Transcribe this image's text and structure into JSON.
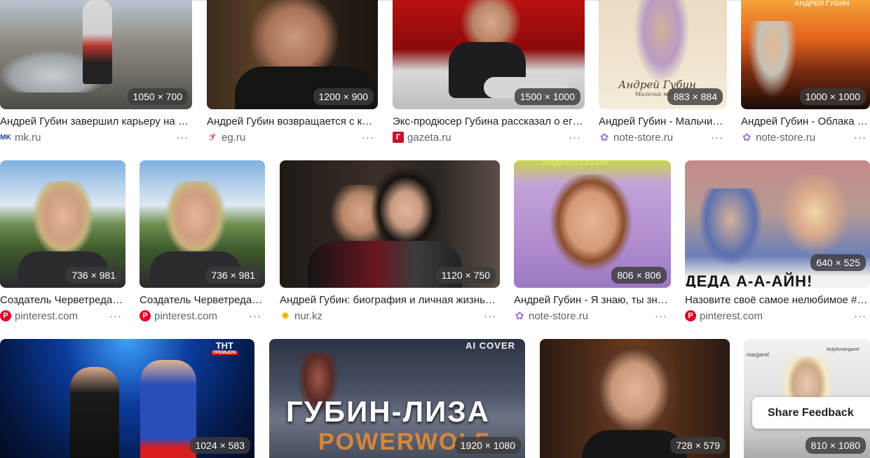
{
  "row1": [
    {
      "dims": "1050 × 700",
      "title": "Андрей Губин завершил карьеру на …",
      "source": "mk.ru",
      "favicon": "mk-favicon"
    },
    {
      "dims": "1200 × 900",
      "title": "Андрей Губин возвращается с к…",
      "source": "eg.ru",
      "favicon": "eg-favicon"
    },
    {
      "dims": "1500 × 1000",
      "title": "Экс-продюсер Губина рассказал о ег…",
      "source": "gazeta.ru",
      "favicon": "gazeta-favicon"
    },
    {
      "dims": "883 × 884",
      "title": "Андрей Губин - Мальчи…",
      "source": "note-store.ru",
      "favicon": "note-store-favicon"
    },
    {
      "dims": "1000 × 1000",
      "title": "Андрей Губин - Облака …",
      "source": "note-store.ru",
      "favicon": "note-store-favicon"
    }
  ],
  "row2": [
    {
      "dims": "736 × 981",
      "title": "Создатель Черветреда…",
      "source": "pinterest.com",
      "favicon": "pinterest-favicon"
    },
    {
      "dims": "736 × 981",
      "title": "Создатель Черветреда…",
      "source": "pinterest.com",
      "favicon": "pinterest-favicon"
    },
    {
      "dims": "1120 × 750",
      "title": "Андрей Губин: биография и личная жизнь…",
      "source": "nur.kz",
      "favicon": "nur-favicon"
    },
    {
      "dims": "806 × 806",
      "title": "Андрей Губин - Я знаю, ты зн…",
      "source": "note-store.ru",
      "favicon": "note-store-favicon"
    },
    {
      "dims": "640 × 525",
      "title": "Назовите своё самое нелюбимое #…",
      "source": "pinterest.com",
      "favicon": "pinterest-favicon"
    }
  ],
  "row3": [
    {
      "dims": "1024 × 583"
    },
    {
      "dims": "1920 × 1080"
    },
    {
      "dims": "728 × 579"
    },
    {
      "dims": "810 × 1080"
    }
  ],
  "overlays": {
    "r1c5_text": "АНДРЕЙ ГУБИН",
    "r2c4_text": "АНДРЕЙ ГУБИН",
    "r2c5_text": "ДЕДА А-А-АЙН!",
    "r3c1_badge": "ТНТ",
    "r3c1_badge_sub": "ПРЕМЬЕРА",
    "r3c2_tag": "AI COVER",
    "r3c2_title": "ГУБИН-ЛИЗА",
    "r3c2_subtitle": "POWERWOLF",
    "r3c4_text": "#stylemargaret",
    "r3c4_text2": "margaret",
    "r1c4_sig": "Андрей Губин",
    "r1c4_sig2": "Мальчик мой"
  },
  "more_label": "···",
  "feedback": {
    "label": "Share Feedback"
  },
  "colors": {
    "text": "#1f1f1f",
    "muted": "#5f6368",
    "badge_bg": "#3c3c3c"
  }
}
